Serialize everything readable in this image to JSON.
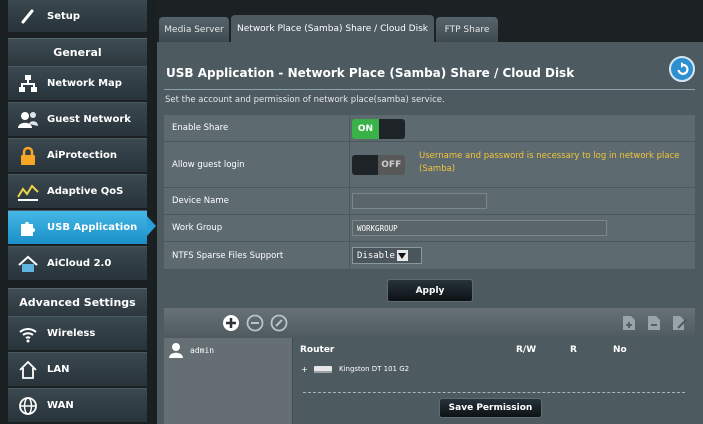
{
  "sidebar": {
    "setup_label": "Setup",
    "general_header": "General",
    "items": [
      {
        "label": "Network Map"
      },
      {
        "label": "Guest Network"
      },
      {
        "label": "AiProtection"
      },
      {
        "label": "Adaptive QoS"
      },
      {
        "label": "USB Application"
      },
      {
        "label": "AiCloud 2.0"
      }
    ],
    "advanced_header": "Advanced Settings",
    "advanced_items": [
      {
        "label": "Wireless"
      },
      {
        "label": "LAN"
      },
      {
        "label": "WAN"
      }
    ]
  },
  "tabs": [
    {
      "label": "Media Server"
    },
    {
      "label": "Network Place (Samba) Share / Cloud Disk"
    },
    {
      "label": "FTP Share"
    }
  ],
  "page": {
    "title": "USB Application - Network Place (Samba) Share / Cloud Disk",
    "description": "Set the account and permission of network place(samba) service."
  },
  "form": {
    "enable_share": {
      "label": "Enable Share",
      "state": "ON"
    },
    "guest_login": {
      "label": "Allow guest login",
      "state": "OFF",
      "note": "Username and password is necessary to log in network place (Samba)"
    },
    "device_name": {
      "label": "Device Name",
      "value": ""
    },
    "work_group": {
      "label": "Work Group",
      "value": "WORKGROUP"
    },
    "ntfs": {
      "label": "NTFS Sparse Files Support",
      "value": "Disable"
    }
  },
  "apply_label": "Apply",
  "permissions": {
    "user": "admin",
    "router_label": "Router",
    "col_rw": "R/W",
    "col_r": "R",
    "col_no": "No",
    "disk_name": "Kingston DT 101 G2",
    "save_label": "Save Permission"
  },
  "colors": {
    "accent": "#2aa0d9",
    "toggle_on": "#3ab24a",
    "warning_text": "#f3c43a"
  }
}
